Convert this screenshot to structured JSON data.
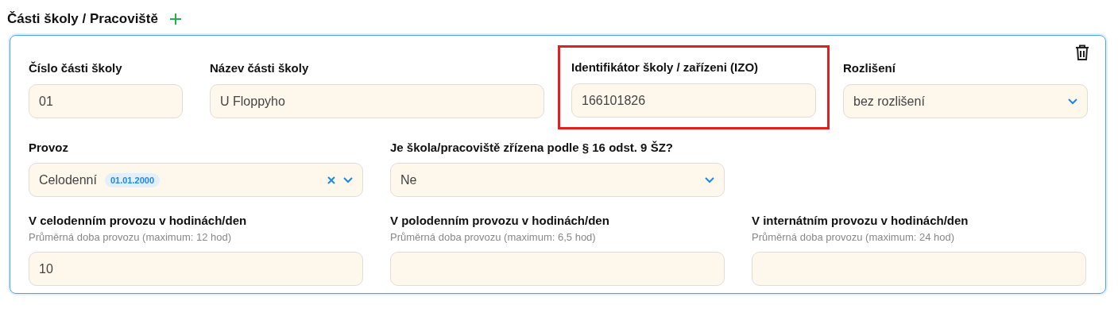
{
  "section": {
    "title": "Části školy / Pracoviště"
  },
  "card": {
    "rows": [
      {
        "fields": [
          {
            "kind": "text",
            "label": "Číslo části školy",
            "value": "01",
            "highlighted": false
          },
          {
            "kind": "text",
            "label": "Název části školy",
            "value": "U Floppyho",
            "highlighted": false
          },
          {
            "kind": "text",
            "label": "Identifikátor školy / zařízeni (IZO)",
            "value": "166101826",
            "highlighted": true
          },
          {
            "kind": "select",
            "label": "Rozlišení",
            "value": "bez rozlišení",
            "highlighted": false,
            "clearable": false
          }
        ]
      },
      {
        "fields": [
          {
            "kind": "select",
            "label": "Provoz",
            "value": "Celodenní",
            "tag": "01.01.2000",
            "highlighted": false,
            "clearable": true
          },
          {
            "kind": "select",
            "label": "Je škola/pracoviště zřízena podle § 16 odst. 9 ŠZ?",
            "value": "Ne",
            "highlighted": false,
            "clearable": false
          }
        ]
      },
      {
        "fields": [
          {
            "kind": "text",
            "label": "V celodenním provozu v hodinách/den",
            "hint": "Průměrná doba provozu (maximum: 12 hod)",
            "value": "10",
            "highlighted": false
          },
          {
            "kind": "text",
            "label": "V polodenním provozu v hodinách/den",
            "hint": "Průměrná doba provozu (maximum: 6,5 hod)",
            "highlighted": false
          },
          {
            "kind": "text",
            "label": "V internátním provozu v hodinách/den",
            "hint": "Průměrná doba provozu (maximum: 24 hod)",
            "highlighted": false
          }
        ]
      }
    ]
  }
}
